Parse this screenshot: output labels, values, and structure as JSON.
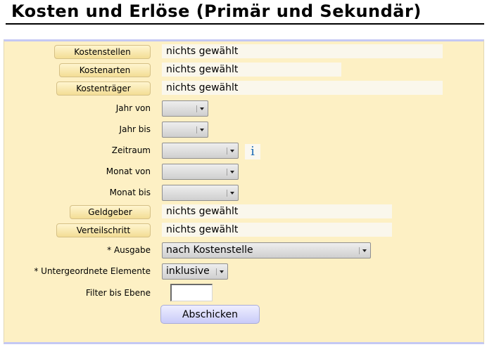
{
  "page": {
    "title": "Kosten und Erlöse (Primär und Sekundär)"
  },
  "form": {
    "kostenstellen": {
      "button_label": "Kostenstellen",
      "value": "nichts gewählt"
    },
    "kostenarten": {
      "button_label": "Kostenarten",
      "value": "nichts gewählt"
    },
    "kostentraeger": {
      "button_label": "Kostenträger",
      "value": "nichts gewählt"
    },
    "jahr_von": {
      "label": "Jahr von",
      "selected": ""
    },
    "jahr_bis": {
      "label": "Jahr bis",
      "selected": ""
    },
    "zeitraum": {
      "label": "Zeitraum",
      "selected": "",
      "info_icon": "i"
    },
    "monat_von": {
      "label": "Monat von",
      "selected": ""
    },
    "monat_bis": {
      "label": "Monat bis",
      "selected": ""
    },
    "geldgeber": {
      "button_label": "Geldgeber",
      "value": "nichts gewählt"
    },
    "verteilschritt": {
      "button_label": "Verteilschritt",
      "value": "nichts gewählt"
    },
    "ausgabe": {
      "label": "* Ausgabe",
      "selected": "nach Kostenstelle"
    },
    "untergeordnete": {
      "label": "* Untergeordnete Elemente",
      "selected": "inklusive"
    },
    "filter_ebene": {
      "label": "Filter bis Ebene",
      "value": ""
    },
    "submit_label": "Abschicken"
  },
  "colors": {
    "panel_background": "#fdf0c4",
    "panel_border": "#c4c8f4",
    "button_gradient_top": "#fff5cf",
    "button_gradient_bottom": "#f3dd95",
    "submit_background": "#c9cbf8",
    "info_icon": "#1a6ab5"
  },
  "icons": {
    "dropdown": "chevron-down-icon",
    "info": "info-icon"
  }
}
